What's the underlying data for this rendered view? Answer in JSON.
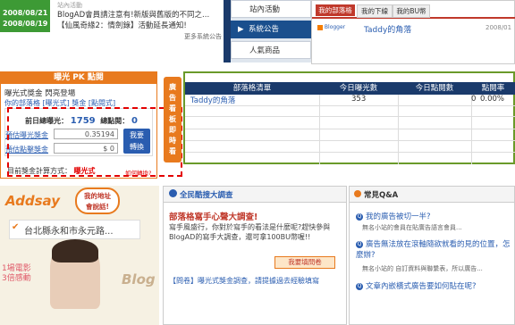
{
  "news": [
    {
      "date": "2008/08/21",
      "text": "BlogAD會員請注意有!新版與舊版的不同之..."
    },
    {
      "date": "2008/08/19",
      "text": "【仙風奇緣2：情劍錄】活動延長通知!"
    }
  ],
  "news_top_text": "站內活動",
  "more_announcements": "更多系統公告",
  "side_nav": [
    {
      "label": "站內活動"
    },
    {
      "label": "系統公告"
    },
    {
      "label": "人氣商品"
    }
  ],
  "tabs": [
    "我的部落格",
    "我的下線",
    "我的BU幣"
  ],
  "blog_entry": {
    "logo": "Blogger",
    "name": "Taddy的角落",
    "date": "2008/01"
  },
  "pk_panel": {
    "title": "曝光 PK 點閱",
    "line1": "曝光式獎金 閃亮登場",
    "line2": "你的部落格 [曝光式] 獎金 [點閱式]",
    "yesterday_label": "前日總曝光：",
    "yesterday_value": "1759",
    "clicks_label": "總點閱：",
    "clicks_value": "0",
    "exposure_link": "預估曝光獎金",
    "exposure_value": "0.35194",
    "click_link": "預估點擊獎金",
    "click_value": "$ 0",
    "switch_button": "我要\n轉換",
    "method_label": "目前獎金計算方式：",
    "method_value": "曝光式",
    "howto_link": "如何轉換?"
  },
  "vertical_tab": "廣告看板即時看",
  "table": {
    "headers": [
      "部落格清單",
      "今日曝光數",
      "今日點閱數",
      "點閱率"
    ],
    "rows": [
      {
        "name": "Taddy的角落",
        "views": "353",
        "clicks": "0",
        "rate": "0.00%"
      }
    ]
  },
  "addsay": {
    "brand": "Addsay",
    "bubble": "我的地址\n會說話!",
    "address": "台北縣永和市永元路...",
    "promo": "1場電影\n3倍感動",
    "blog": "Blog"
  },
  "survey": {
    "title": "全民酷搜大調查",
    "headline": "部落格寫手心聲大調查!",
    "body": "寫手風盛行，你對於寫手的看法是什麼呢?趕快參與BlogAD的寫手大調查，還可拿100BU幣喔!!",
    "button": "我要填問卷",
    "footer": "【問卷】曝光式獎金調查，請提據過去經驗填寫"
  },
  "faq": {
    "title": "常見Q&A",
    "items": [
      {
        "q": "我的廣告被切一半?",
        "sub": "無名小站的會員在貼廣告語言會員..."
      },
      {
        "q": "廣告無法放在滾軸隨欲就看的見的位置，怎麼辦?",
        "sub": "無名小站的 自訂資料與聯繫表，所以廣告..."
      },
      {
        "q": "文章內嵌橫式廣告要如何貼在呢?",
        "sub": ""
      }
    ]
  },
  "colors": {
    "green": "#3d9a35",
    "navy": "#1a3a6b",
    "orange": "#e87a1e",
    "red": "#e30000"
  }
}
